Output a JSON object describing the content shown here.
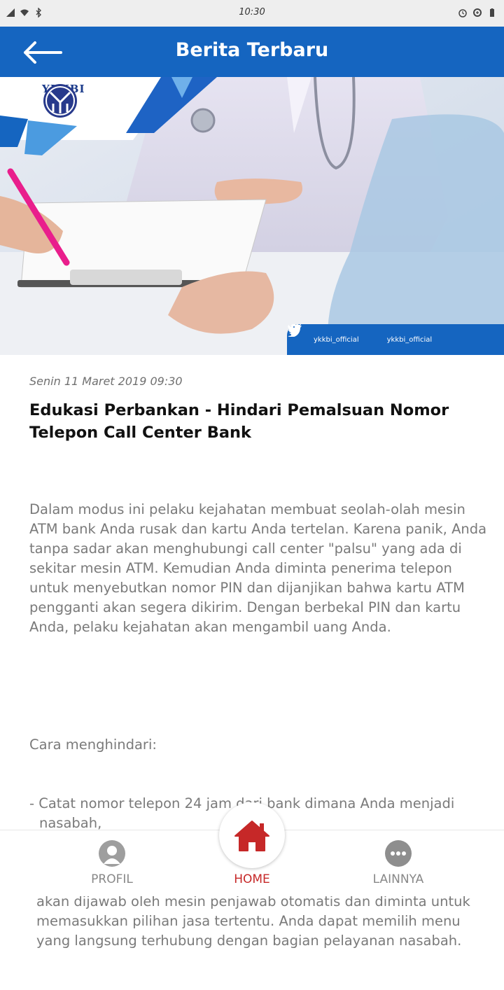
{
  "status_bar": {
    "time": "10:30"
  },
  "header": {
    "title": "Berita Terbaru"
  },
  "hero": {
    "logo_text": "YKKBI",
    "social": [
      {
        "icon": "facebook-icon",
        "handle": "ykkbi_official"
      },
      {
        "icon": "twitter-icon",
        "handle": "ykkbi_official"
      }
    ]
  },
  "article": {
    "date": "Senin 11 Maret 2019 09:30",
    "title": "Edukasi Perbankan - Hindari Pemalsuan Nomor Telepon Call Center Bank",
    "paragraph": "Dalam modus ini pelaku kejahatan membuat seolah-olah mesin ATM bank Anda rusak dan kartu Anda tertelan. Karena panik, Anda tanpa sadar akan menghubungi call center \"palsu\" yang ada di sekitar mesin ATM. Kemudian Anda diminta penerima telepon untuk menyebutkan nomor PIN dan dijanjikan bahwa kartu ATM pengganti akan segera dikirim. Dengan berbekal PIN dan kartu Anda, pelaku kejahatan akan mengambil uang Anda.",
    "tips_heading": "Cara menghindari:",
    "tips": [
      "- Catat nomor telepon 24 jam dari bank dimana Anda menjadi nasabah,",
      "- Jika Anda menghubungi nomor tersebut, pada umumnya Anda akan dijawab oleh mesin penjawab otomatis dan diminta untuk memasukkan pilihan jasa tertentu. Anda dapat memilih menu yang langsung terhubung dengan bagian pelayanan nasabah."
    ]
  },
  "bottom_nav": {
    "profil": "PROFIL",
    "home": "HOME",
    "lainnya": "LAINNYA"
  },
  "colors": {
    "primary": "#1565c0",
    "accent": "#c62828"
  }
}
